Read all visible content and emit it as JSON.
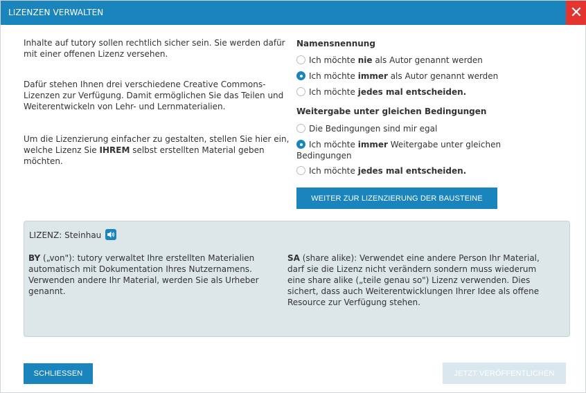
{
  "dialog": {
    "title": "LIZENZEN VERWALTEN",
    "close_symbol": "✕"
  },
  "intro": {
    "p1": "Inhalte auf tutory sollen rechtlich sicher sein. Sie werden dafür mit einer offenen Lizenz versehen.",
    "p2": "Dafür stehen Ihnen drei verschiedene Creative Commons-Lizenzen zur Verfügung. Damit ermöglichen Sie das Teilen und Weiterentwickeln von Lehr- und Lernmaterialien.",
    "p3_a": "Um die Lizenzierung einfacher zu gestalten, stellen Sie hier ein, welche Lizenz Sie ",
    "p3_b": "IHREM",
    "p3_c": " selbst erstellten Material geben möchten."
  },
  "attribution": {
    "heading": "Namensnennung",
    "options": [
      {
        "pre": "Ich möchte ",
        "bold": "nie",
        "post": " als Autor genannt werden",
        "checked": false
      },
      {
        "pre": "Ich möchte ",
        "bold": "immer",
        "post": " als Autor genannt werden",
        "checked": true
      },
      {
        "pre": "Ich möchte ",
        "bold": "jedes mal entscheiden.",
        "post": "",
        "checked": false
      }
    ]
  },
  "sharealike": {
    "heading": "Weitergabe unter gleichen Bedingungen",
    "options": [
      {
        "pre": "Die Bedingungen sind mir egal",
        "bold": "",
        "post": "",
        "checked": false
      },
      {
        "pre": "Ich möchte ",
        "bold": "immer",
        "post": " Weitergabe unter gleichen Bedingungen",
        "checked": true
      },
      {
        "pre": "Ich möchte ",
        "bold": "jedes mal entscheiden.",
        "post": "",
        "checked": false
      }
    ]
  },
  "next_button": "WEITER ZUR LIZENZIERUNG DER BAUSTEINE",
  "license": {
    "title": "LIZENZ: Steinhau",
    "speaker_icon": "speaker-icon",
    "by_bold": "BY",
    "by_text": " („von\"): tutory verwaltet Ihre erstellten Materialien automatisch mit Dokumentation Ihres Nutzernamens. Verwenden andere Ihr Material, werden Sie als Urheber genannt.",
    "sa_bold": "SA",
    "sa_text": " (share alike): Verwendet eine andere Person Ihr Material, darf sie die Lizenz nicht verändern sondern muss wiederum eine share alike („teile genau so\") Lizenz verwenden. Dies sichert, dass auch Weiterentwicklungen Ihrer Idee als offene Resource zur Verfügung stehen."
  },
  "footer": {
    "close_label": "SCHLIESSEN",
    "publish_label": "JETZT VERÖFFENTLICHEN"
  },
  "colors": {
    "primary": "#1a84bd",
    "close": "#e3342f",
    "license_bg": "#dde6e8",
    "disabled": "#d9e7ee"
  }
}
